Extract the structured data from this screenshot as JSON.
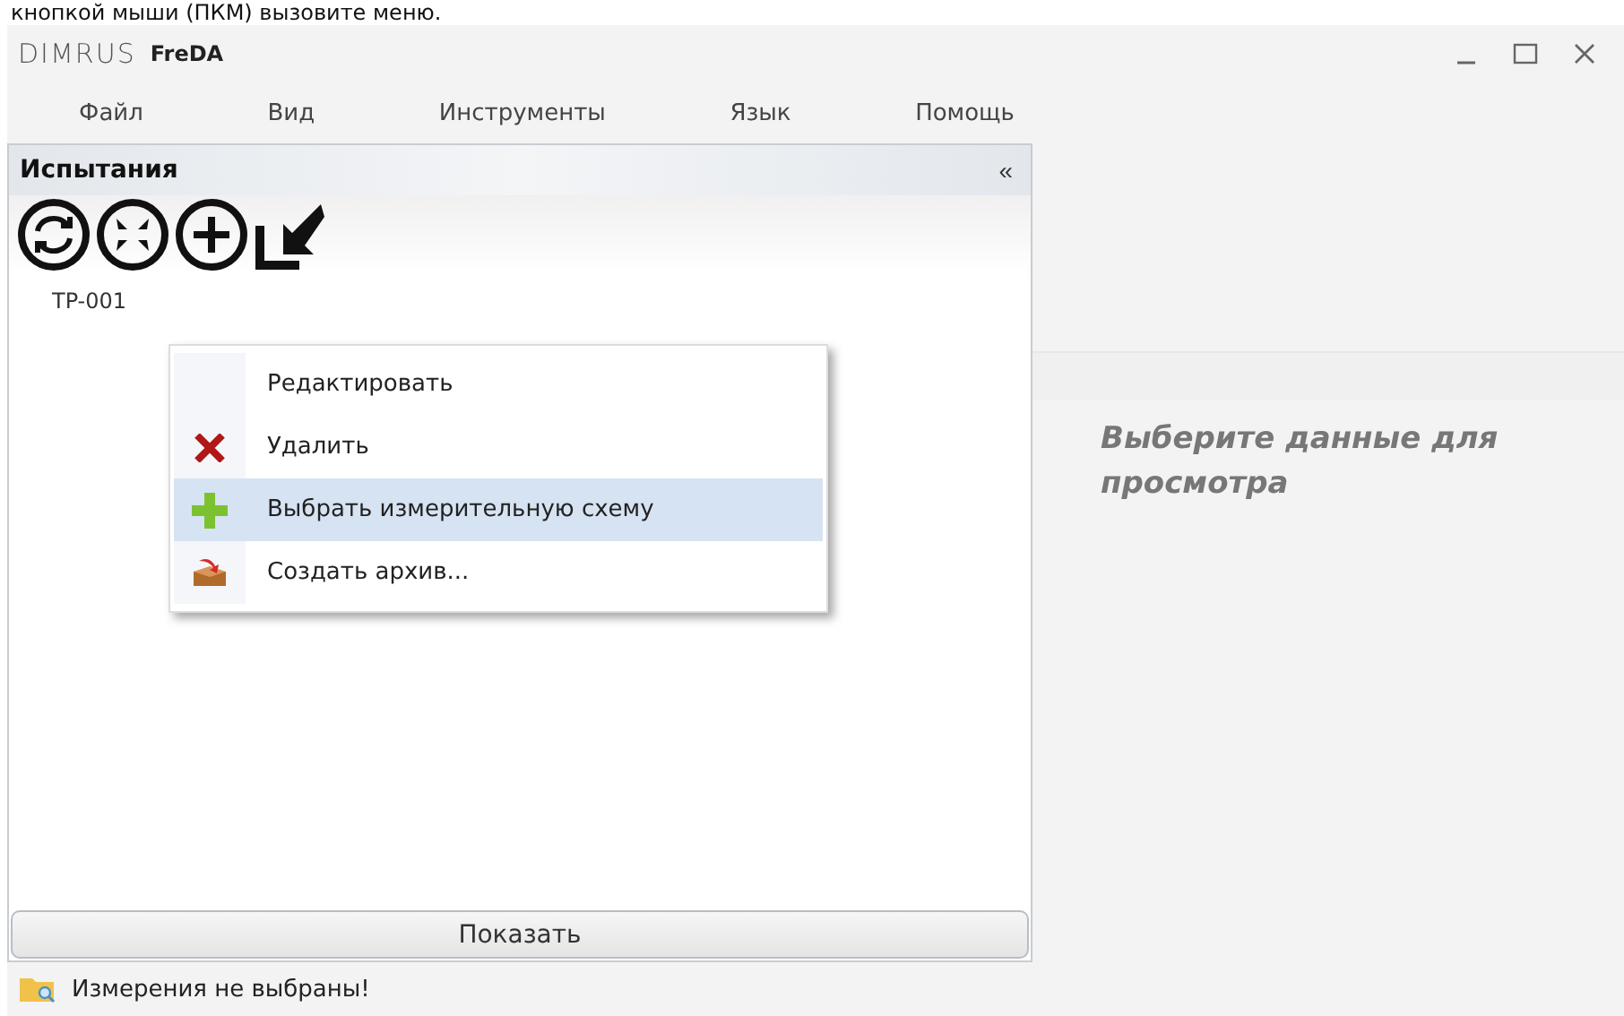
{
  "caption": "кнопкой мыши (ПКМ) вызовите меню.",
  "window": {
    "logo": "DIMRUS",
    "title": "FreDA"
  },
  "menu": [
    "Файл",
    "Вид",
    "Инструменты",
    "Язык",
    "Помощь"
  ],
  "panel": {
    "title": "Испытания",
    "collapse": "«"
  },
  "tree": [
    {
      "label": "TP-001",
      "selected": false
    }
  ],
  "context_menu": [
    {
      "label": "Редактировать",
      "kind": "none",
      "selected": false
    },
    {
      "label": "Удалить",
      "kind": "delete",
      "selected": false
    },
    {
      "label": "Выбрать измерительную схему",
      "kind": "add",
      "selected": true
    },
    {
      "label": "Создать архив...",
      "kind": "archive",
      "selected": false
    }
  ],
  "show_button": "Показать",
  "status": "Измерения не выбраны!",
  "viewer": {
    "message": "Выберите данные для просмотра"
  }
}
